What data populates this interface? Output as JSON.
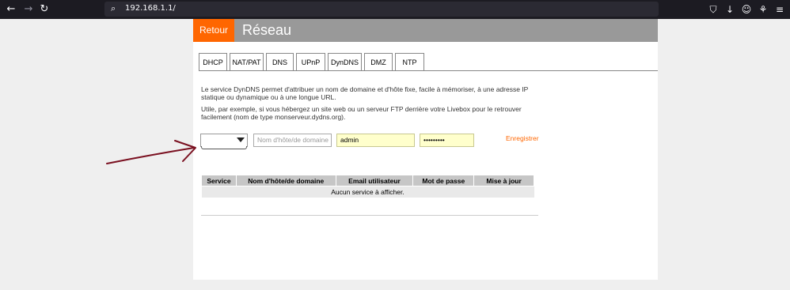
{
  "browser": {
    "url": "192.168.1.1/",
    "back_glyph": "←",
    "forward_glyph": "→",
    "reload_glyph": "↻",
    "search_glyph": "⌕",
    "toolbar_glyphs": [
      "⛉",
      "↓",
      "☺",
      "⚘",
      "≡"
    ]
  },
  "header": {
    "back_label": "Retour",
    "title": "Réseau"
  },
  "tabs": [
    {
      "label": "DHCP"
    },
    {
      "label": "NAT/PAT"
    },
    {
      "label": "DNS"
    },
    {
      "label": "UPnP"
    },
    {
      "label": "DynDNS"
    },
    {
      "label": "DMZ"
    },
    {
      "label": "NTP"
    }
  ],
  "description": {
    "para1": "Le service DynDNS permet d'attribuer un nom de domaine et d'hôte fixe, facile à mémoriser, à une adresse IP statique ou dynamique ou à une longue URL.",
    "para2": "Utile, par exemple, si vous hébergez un site web ou un serveur FTP derrière votre Livebox pour le retrouver facilement (nom de type monserveur.dydns.org)."
  },
  "form": {
    "service_value": "",
    "host_placeholder": "Nom d'hôte/de domaine",
    "user_value": "admin",
    "password_value": "•••••••••",
    "save_label": "Enregistrer"
  },
  "table": {
    "headers": [
      "Service",
      "Nom d'hôte/de domaine",
      "Email utilisateur",
      "Mot de passe",
      "Mise à jour"
    ],
    "empty_message": "Aucun service à afficher."
  },
  "colors": {
    "accent": "#ff6600",
    "header_bg": "#999999",
    "annotation_arrow": "#7a1020"
  }
}
